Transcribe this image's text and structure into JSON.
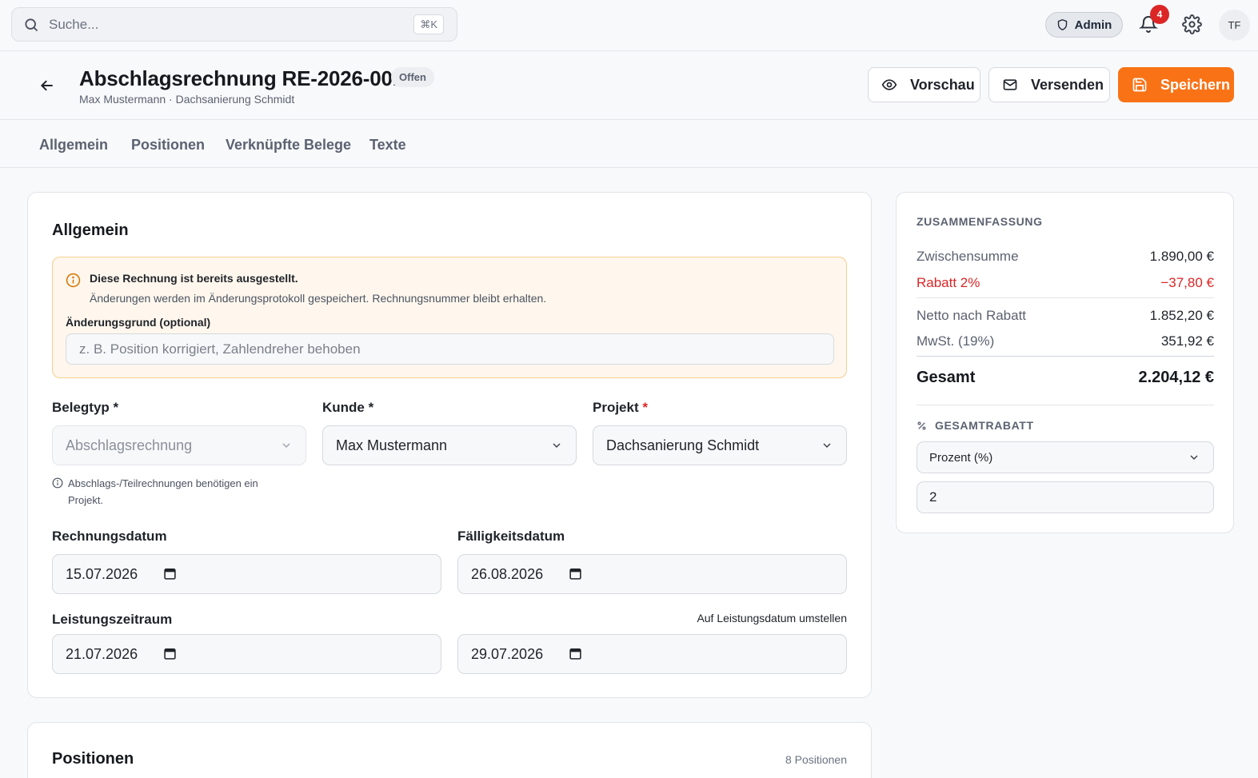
{
  "topbar": {
    "search_placeholder": "Suche...",
    "search_shortcut": "⌘K",
    "role": "Admin",
    "notification_count": "4",
    "user_initials": "TF"
  },
  "header": {
    "title": "Abschlagsrechnung RE-2026-0011",
    "status": "Offen",
    "subtitle": "Max Mustermann · Dachsanierung Schmidt",
    "preview_label": "Vorschau",
    "send_label": "Versenden",
    "save_label": "Speichern"
  },
  "tabs": [
    {
      "label": "Allgemein"
    },
    {
      "label": "Positionen"
    },
    {
      "label": "Verknüpfte Belege"
    },
    {
      "label": "Texte"
    }
  ],
  "general": {
    "title": "Allgemein",
    "notice": {
      "heading": "Diese Rechnung ist bereits ausgestellt.",
      "text": "Änderungen werden im Änderungsprotokoll gespeichert. Rechnungsnummer bleibt erhalten.",
      "reason_label": "Änderungsgrund (optional)",
      "reason_placeholder": "z. B. Position korrigiert, Zahlendreher behoben"
    },
    "doc_type_label": "Belegtyp *",
    "doc_type_value": "Abschlagsrechnung",
    "customer_label": "Kunde *",
    "customer_value": "Max Mustermann",
    "project_label": "Projekt",
    "project_required": "*",
    "project_value": "Dachsanierung Schmidt",
    "doc_type_hint": "Abschlags-/Teilrechnungen benötigen ein Projekt.",
    "invoice_date_label": "Rechnungsdatum",
    "invoice_date": "15.07.2026",
    "due_date_label": "Fälligkeitsdatum",
    "due_date": "26.08.2026",
    "service_period_label": "Leistungszeitraum",
    "switch_link": "Auf Leistungsdatum umstellen",
    "period_start": "21.07.2026",
    "period_end": "29.07.2026"
  },
  "positions": {
    "title": "Positionen",
    "count": "8 Positionen"
  },
  "summary": {
    "heading": "ZUSAMMENFASSUNG",
    "subtotal_label": "Zwischensumme",
    "subtotal": "1.890,00 €",
    "discount_label": "Rabatt 2%",
    "discount": "−37,80 €",
    "net_label": "Netto nach Rabatt",
    "net": "1.852,20 €",
    "vat_label": "MwSt. (19%)",
    "vat": "351,92 €",
    "total_label": "Gesamt",
    "total": "2.204,12 €",
    "discount_heading": "GESAMTRABATT",
    "discount_type": "Prozent (%)",
    "discount_value": "2"
  },
  "colors": {
    "accent": "#f97316",
    "danger": "#dc2626",
    "warning_bg": "#fff7ed",
    "warning_border": "#f5cf8e"
  }
}
